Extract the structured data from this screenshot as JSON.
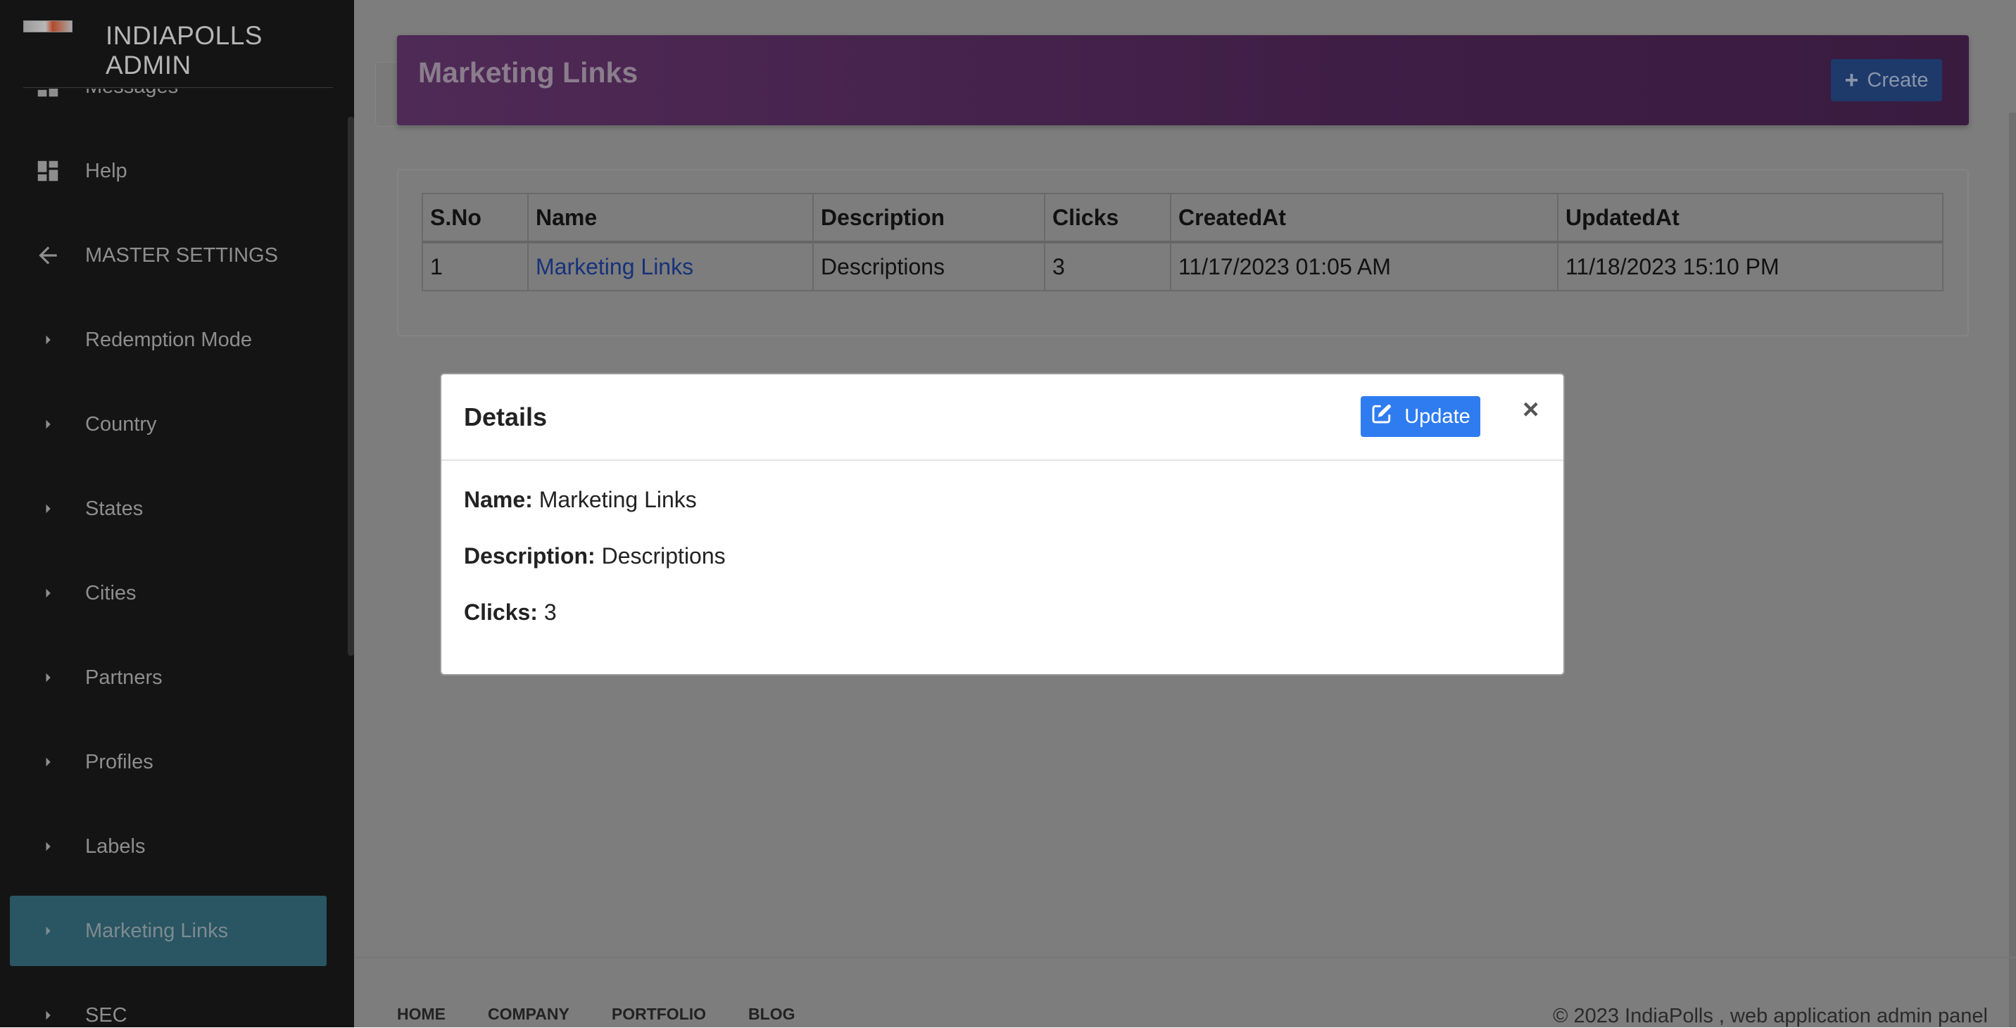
{
  "sidebar": {
    "brand": "INDIAPOLLS ADMIN",
    "items": [
      {
        "label": "Messages",
        "icon": "dashboard-icon"
      },
      {
        "label": "Help",
        "icon": "dashboard-icon"
      },
      {
        "label": "MASTER SETTINGS",
        "icon": "arrow-left-icon"
      },
      {
        "label": "Redemption Mode",
        "icon": "caret-right-icon"
      },
      {
        "label": "Country",
        "icon": "caret-right-icon"
      },
      {
        "label": "States",
        "icon": "caret-right-icon"
      },
      {
        "label": "Cities",
        "icon": "caret-right-icon"
      },
      {
        "label": "Partners",
        "icon": "caret-right-icon"
      },
      {
        "label": "Profiles",
        "icon": "caret-right-icon"
      },
      {
        "label": "Labels",
        "icon": "caret-right-icon"
      },
      {
        "label": "Marketing Links",
        "icon": "caret-right-icon",
        "active": true
      },
      {
        "label": "SEC",
        "icon": "caret-right-icon"
      }
    ]
  },
  "header": {
    "title": "Marketing Links",
    "create_label": "Create"
  },
  "table": {
    "columns": [
      "S.No",
      "Name",
      "Description",
      "Clicks",
      "CreatedAt",
      "UpdatedAt"
    ],
    "rows": [
      {
        "sno": "1",
        "name": "Marketing Links",
        "description": "Descriptions",
        "clicks": "3",
        "created": "11/17/2023 01:05 AM",
        "updated": "11/18/2023 15:10 PM"
      }
    ]
  },
  "modal": {
    "title": "Details",
    "update_label": "Update",
    "close_symbol": "×",
    "name_label": "Name:",
    "name_value": "Marketing Links",
    "description_label": "Description:",
    "description_value": "Descriptions",
    "clicks_label": "Clicks:",
    "clicks_value": "3"
  },
  "footer": {
    "links": [
      "HOME",
      "COMPANY",
      "PORTFOLIO",
      "BLOG"
    ],
    "copyright": "© 2023 IndiaPolls , web application admin panel"
  },
  "colors": {
    "sidebar_bg": "#141414",
    "active_item": "#2a5563",
    "title_bar": "#4f2a56",
    "update_button": "#2f7cf0",
    "link": "#17327a"
  }
}
